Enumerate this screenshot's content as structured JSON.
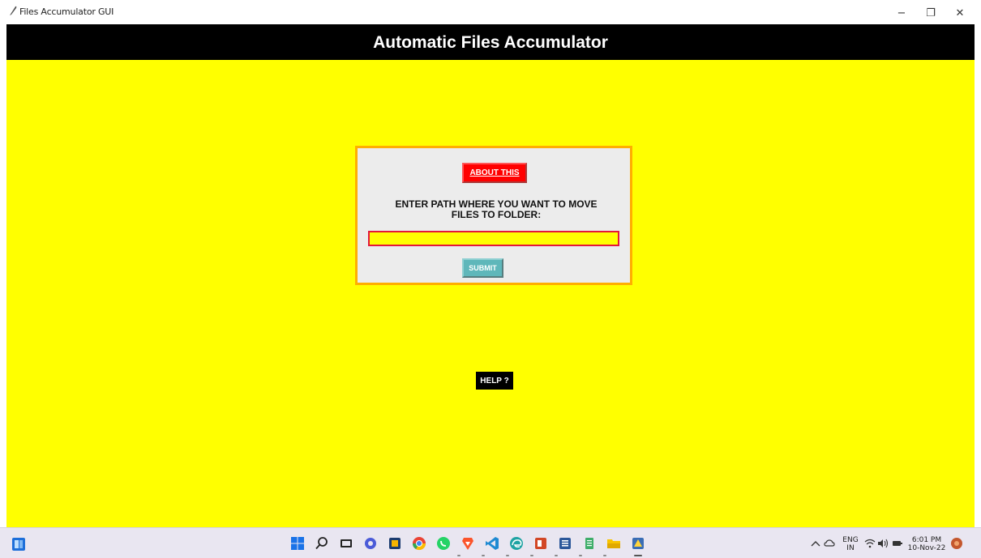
{
  "window": {
    "title": "Files Accumulator GUI",
    "minimize_icon": "−",
    "maximize_icon": "❐",
    "close_icon": "✕"
  },
  "header": {
    "title": "Automatic Files Accumulator"
  },
  "form": {
    "about_label": "ABOUT THIS",
    "path_label_line1": "ENTER PATH WHERE YOU WANT TO MOVE",
    "path_label_line2": "FILES TO FOLDER:",
    "path_value": "",
    "submit_label": "SUBMIT"
  },
  "help": {
    "label": "HELP ?"
  },
  "taskbar": {
    "language_line1": "ENG",
    "language_line2": "IN",
    "time": "6:01 PM",
    "date": "10-Nov-22"
  },
  "colors": {
    "background": "#ffff00",
    "header": "#000000",
    "about_button": "#ff0000",
    "submit_button": "#5fb7ba",
    "form_border": "#ffae00",
    "input_border": "#e4163a"
  }
}
